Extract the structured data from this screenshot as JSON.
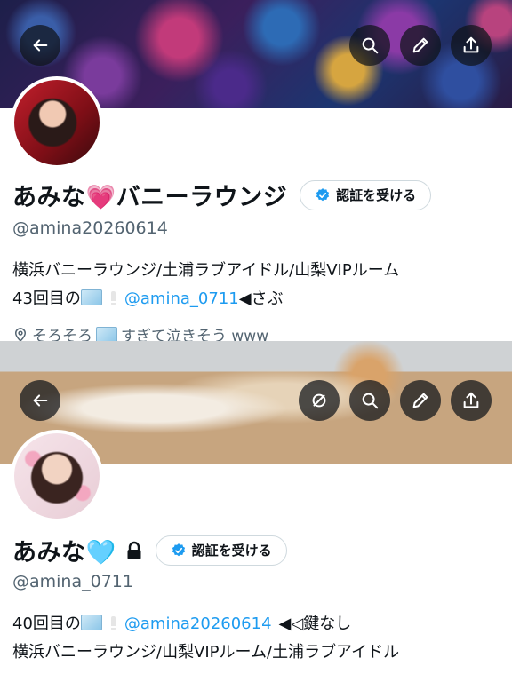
{
  "colors": {
    "accent": "#1d9bf0",
    "secondary_text": "#536471",
    "verified_blue": "#1d9bf0"
  },
  "profile_1": {
    "display_name": "あみな💗バニーラウンジ",
    "verify_label": "認証を受ける",
    "handle": "@amina20260614",
    "bio_line1": "横浜バニーラウンジ/土浦ラブアイドル/山梨VIPルーム",
    "bio_line2_prefix": "43回目の",
    "bio_line2_mention": "@amina_0711",
    "bio_line2_suffix": "◀さぶ",
    "location": "そろそろ",
    "location_suffix": "すぎて泣きそう www",
    "icons": [
      "back-arrow-icon",
      "search-icon",
      "edit-pencil-icon",
      "share-icon",
      "location-pin-icon",
      "verified-badge-icon"
    ]
  },
  "profile_2": {
    "display_name": "あみな🩵",
    "verify_label": "認証を受ける",
    "handle": "@amina_0711",
    "bio_line1_prefix": "40回目の",
    "bio_line1_mention": "@amina20260614",
    "bio_line1_suffix": "◀◁鍵なし",
    "bio_line2": "横浜バニーラウンジ/山梨VIPルーム/土浦ラブアイドル",
    "icons": [
      "back-arrow-icon",
      "grok-icon",
      "search-icon",
      "edit-pencil-icon",
      "share-icon",
      "lock-icon",
      "verified-badge-icon"
    ]
  }
}
